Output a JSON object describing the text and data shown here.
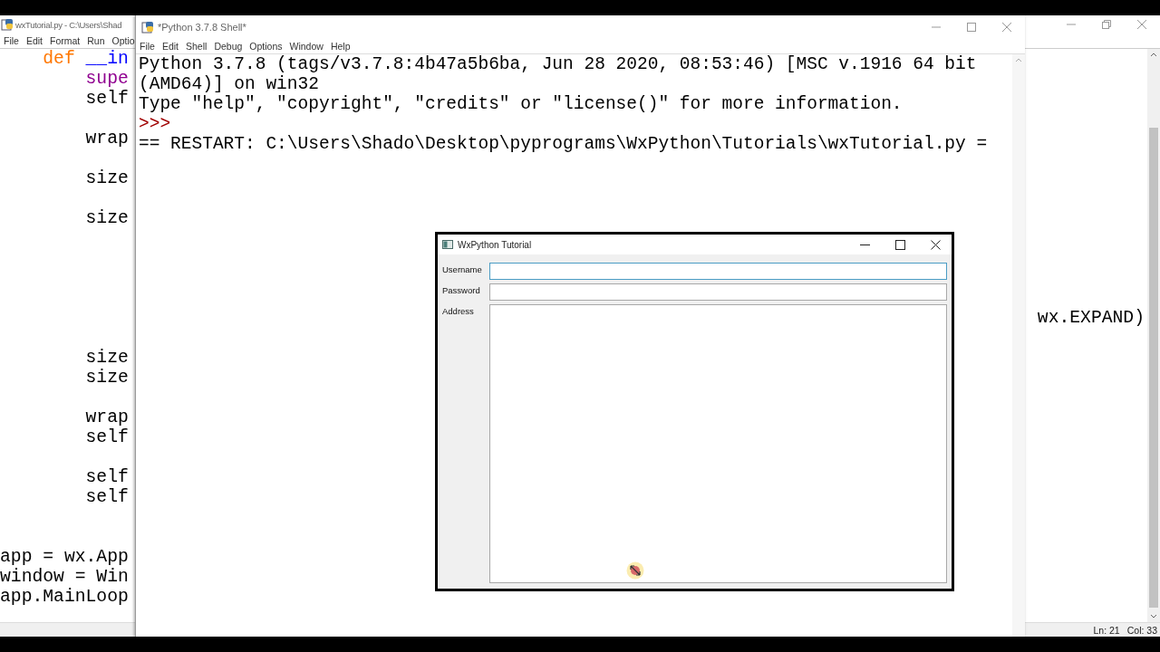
{
  "editor_window": {
    "title": "wxTutorial.py - C:\\Users\\Shad",
    "menu": [
      "File",
      "Edit",
      "Format",
      "Run",
      "Optio"
    ],
    "code_lines": [
      {
        "left": [
          {
            "text": "    def",
            "kind": "keyword"
          },
          {
            "text": "__in",
            "kind": "definition"
          }
        ]
      },
      {
        "left": [
          {
            "text": "        supe",
            "kind": "builtin"
          }
        ]
      },
      {
        "left": [
          {
            "text": "        self",
            "kind": "plain"
          }
        ]
      },
      {
        "blank": true
      },
      {
        "left": [
          {
            "text": "        wrap",
            "kind": "plain"
          }
        ]
      },
      {
        "blank": true
      },
      {
        "left": [
          {
            "text": "        size",
            "kind": "plain"
          }
        ]
      },
      {
        "blank": true
      },
      {
        "left": [
          {
            "text": "        size",
            "kind": "plain"
          }
        ]
      },
      {
        "blank": true
      },
      {
        "blank": true
      },
      {
        "blank": true
      },
      {
        "blank": true
      },
      {
        "right": "wx.EXPAND)"
      },
      {
        "blank": true
      },
      {
        "left": [
          {
            "text": "        size",
            "kind": "plain"
          }
        ]
      },
      {
        "left": [
          {
            "text": "        size",
            "kind": "plain"
          }
        ]
      },
      {
        "blank": true
      },
      {
        "left": [
          {
            "text": "        wrap",
            "kind": "plain"
          }
        ]
      },
      {
        "left": [
          {
            "text": "        self",
            "kind": "plain"
          }
        ]
      },
      {
        "blank": true
      },
      {
        "left": [
          {
            "text": "        self",
            "kind": "plain"
          }
        ]
      },
      {
        "left": [
          {
            "text": "        self",
            "kind": "plain"
          }
        ]
      },
      {
        "blank": true
      },
      {
        "blank": true
      },
      {
        "left": [
          {
            "text": "app = wx.App",
            "kind": "plain"
          }
        ]
      },
      {
        "left": [
          {
            "text": "window = Win",
            "kind": "plain"
          }
        ]
      },
      {
        "left": [
          {
            "text": "app.MainLoop",
            "kind": "plain"
          }
        ]
      }
    ],
    "status_bar": {
      "line": "Ln: 21",
      "column": "Col: 33"
    }
  },
  "shell_window": {
    "title": "*Python 3.7.8 Shell*",
    "menu": [
      "File",
      "Edit",
      "Shell",
      "Debug",
      "Options",
      "Window",
      "Help"
    ],
    "lines": [
      {
        "kind": "output",
        "text": "Python 3.7.8 (tags/v3.7.8:4b47a5b6ba, Jun 28 2020, 08:53:46) [MSC v.1916 64 bit"
      },
      {
        "kind": "output",
        "text": "(AMD64)] on win32"
      },
      {
        "kind": "output",
        "text": "Type \"help\", \"copyright\", \"credits\" or \"license()\" for more information."
      },
      {
        "kind": "prompt",
        "text": ">>>"
      },
      {
        "kind": "output",
        "text": "== RESTART: C:\\Users\\Shado\\Desktop\\pyprograms\\WxPython\\Tutorials\\wxTutorial.py ="
      }
    ]
  },
  "dialog": {
    "title": "WxPython Tutorial",
    "fields": [
      {
        "label": "Username",
        "kind": "single",
        "focused": true
      },
      {
        "label": "Password",
        "kind": "single",
        "focused": false
      },
      {
        "label": "Address",
        "kind": "multiline",
        "focused": false
      }
    ]
  }
}
